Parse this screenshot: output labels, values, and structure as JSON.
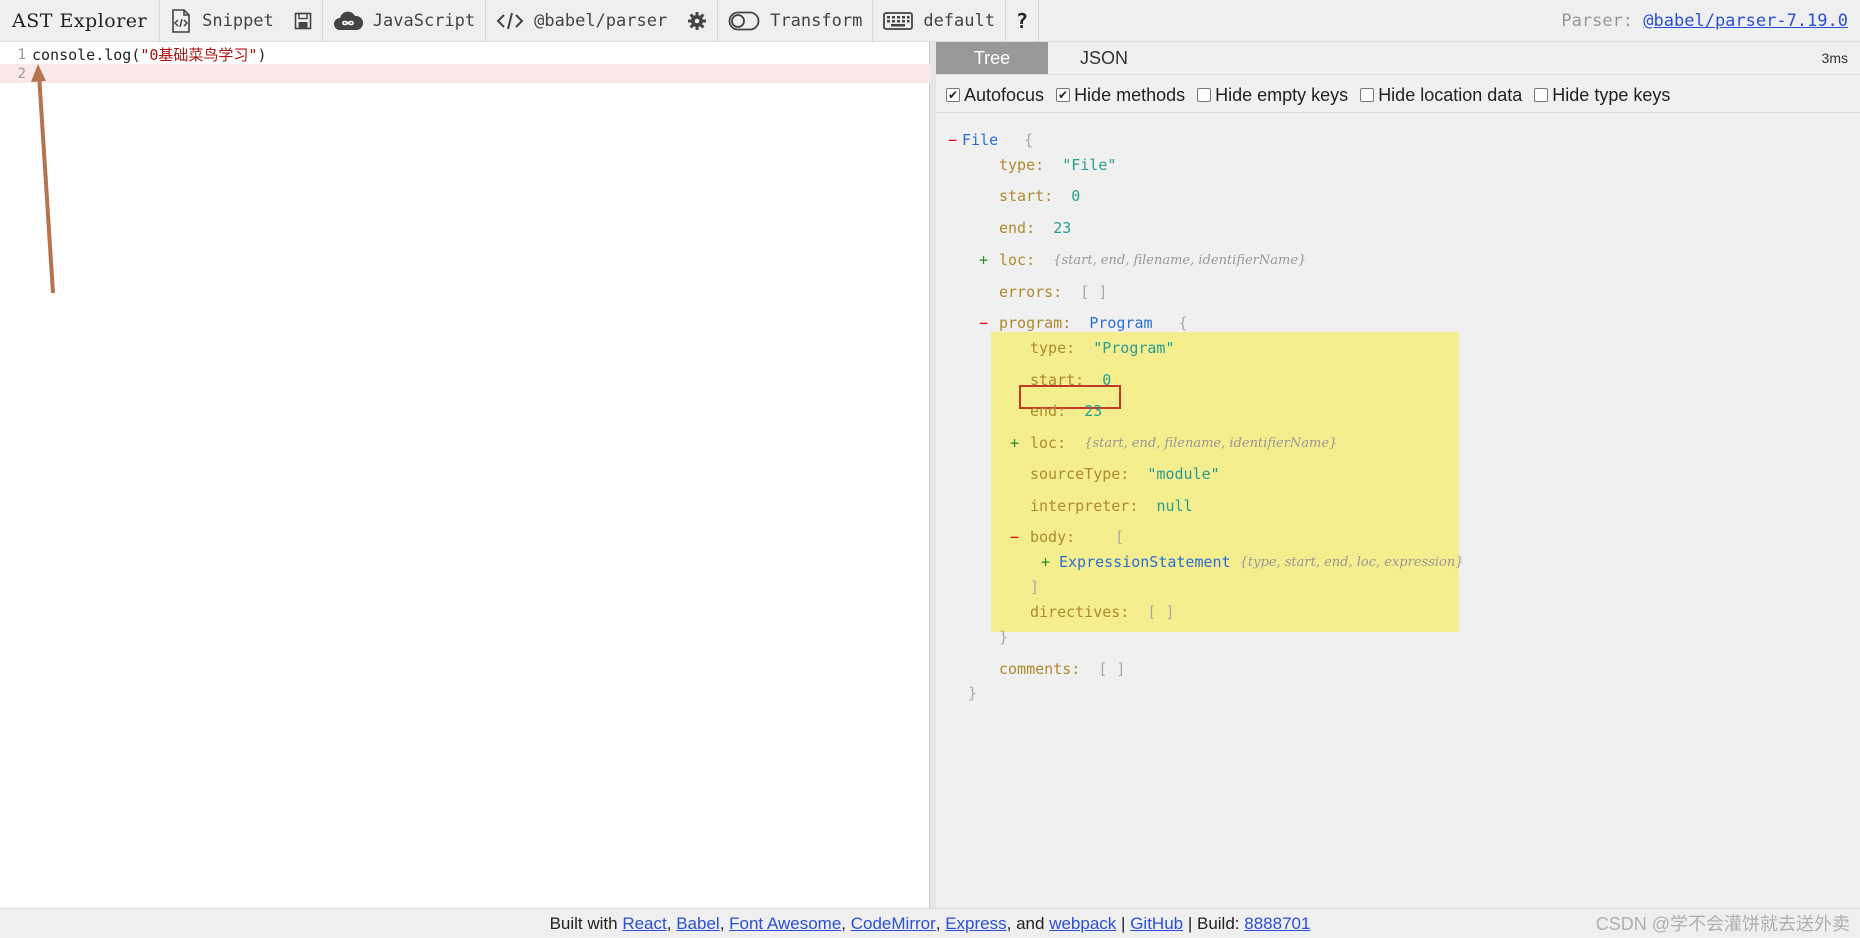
{
  "toolbar": {
    "brand": "AST Explorer",
    "snippet": "Snippet",
    "language": "JavaScript",
    "parser": "@babel/parser",
    "transform": "Transform",
    "keymap": "default",
    "help": "?",
    "parser_label": "Parser:",
    "parser_version": "@babel/parser-7.19.0"
  },
  "editor": {
    "lines": [
      {
        "num": "1",
        "pre": "console.log(",
        "str": "\"0基础菜鸟学习\"",
        "post": ")"
      },
      {
        "num": "2",
        "pre": "",
        "str": "",
        "post": ""
      }
    ]
  },
  "panel": {
    "tabs": [
      "Tree",
      "JSON"
    ],
    "active_tab": "Tree",
    "timing": "3ms",
    "options": [
      {
        "label": "Autofocus",
        "checked": true
      },
      {
        "label": "Hide methods",
        "checked": true
      },
      {
        "label": "Hide empty keys",
        "checked": false
      },
      {
        "label": "Hide location data",
        "checked": false
      },
      {
        "label": "Hide type keys",
        "checked": false
      }
    ]
  },
  "tree": {
    "file": "File",
    "file_type_key": "type:",
    "file_type_val": "\"File\"",
    "start_key": "start:",
    "start_val": "0",
    "end_key": "end:",
    "end_val": "23",
    "loc_key": "loc:",
    "loc_summary": "{start, end, filename, identifierName}",
    "errors_key": "errors:",
    "errors_val": "[ ]",
    "program_key": "program:",
    "program_type": "Program",
    "prog_type_key": "type:",
    "prog_type_val": "\"Program\"",
    "prog_start_key": "start:",
    "prog_start_val": "0",
    "prog_end_key": "end:",
    "prog_end_val": "23",
    "prog_loc_key": "loc:",
    "prog_loc_summary": "{start, end, filename, identifierName}",
    "source_type_key": "sourceType:",
    "source_type_val": "\"module\"",
    "interpreter_key": "interpreter:",
    "interpreter_val": "null",
    "body_key": "body:",
    "body_item": "ExpressionStatement",
    "body_item_summary": "{type, start, end, loc, expression}",
    "directives_key": "directives:",
    "directives_val": "[ ]",
    "comments_key": "comments:",
    "comments_val": "[ ]",
    "open_brace": "{",
    "close_brace": "}",
    "open_bracket": "[",
    "close_bracket": "]"
  },
  "footer": {
    "prefix": "Built with",
    "links": [
      "React",
      "Babel",
      "Font Awesome",
      "CodeMirror",
      "Express"
    ],
    "and": "and",
    "last_link": "webpack",
    "github": "GitHub",
    "build_label": "Build:",
    "build": "8888701"
  },
  "watermark": "CSDN @学不会灌饼就去送外卖",
  "colors": {
    "highlight": "#f5ee8f",
    "red_box": "#c0392b",
    "arrow": "#b5734f"
  }
}
